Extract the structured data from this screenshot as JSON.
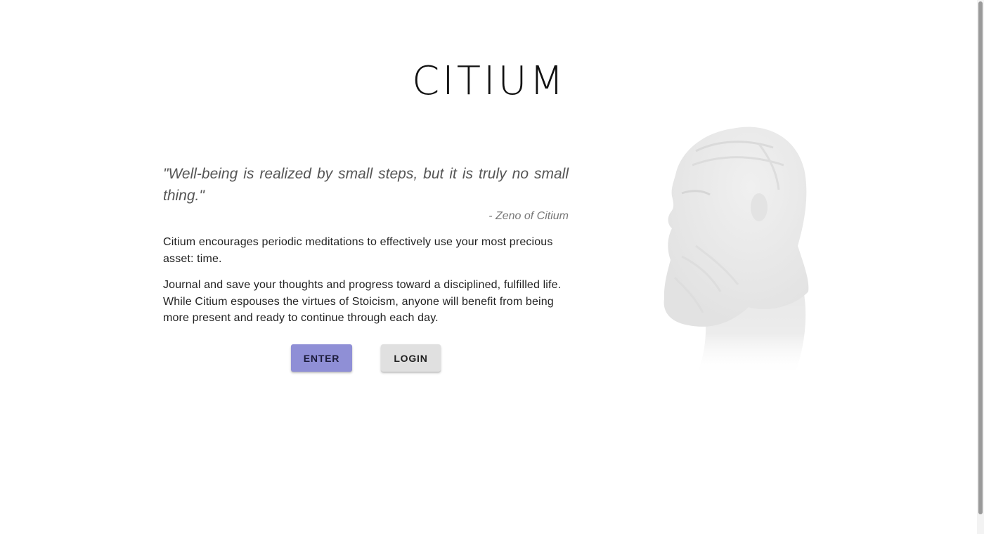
{
  "header": {
    "logo_text": "CITIUM"
  },
  "hero": {
    "quote": "\"Well-being is realized by small steps, but it is truly no small thing.\"",
    "attribution": "- Zeno of Citium",
    "paragraphs": [
      "Citium encourages periodic meditations to effectively use your most precious asset: time.",
      "Journal and save your thoughts and progress toward a disciplined, fulfilled life. While Citium espouses the virtues of Stoicism, anyone will benefit from being more present and ready to continue through each day."
    ]
  },
  "actions": {
    "enter_label": "ENTER",
    "login_label": "LOGIN"
  },
  "colors": {
    "enter_button": "#8f8fd6",
    "login_button": "#e0e0e0",
    "bust_tint": "#e9e9e9"
  },
  "illustration": {
    "icon": "zeno-bust-icon"
  }
}
